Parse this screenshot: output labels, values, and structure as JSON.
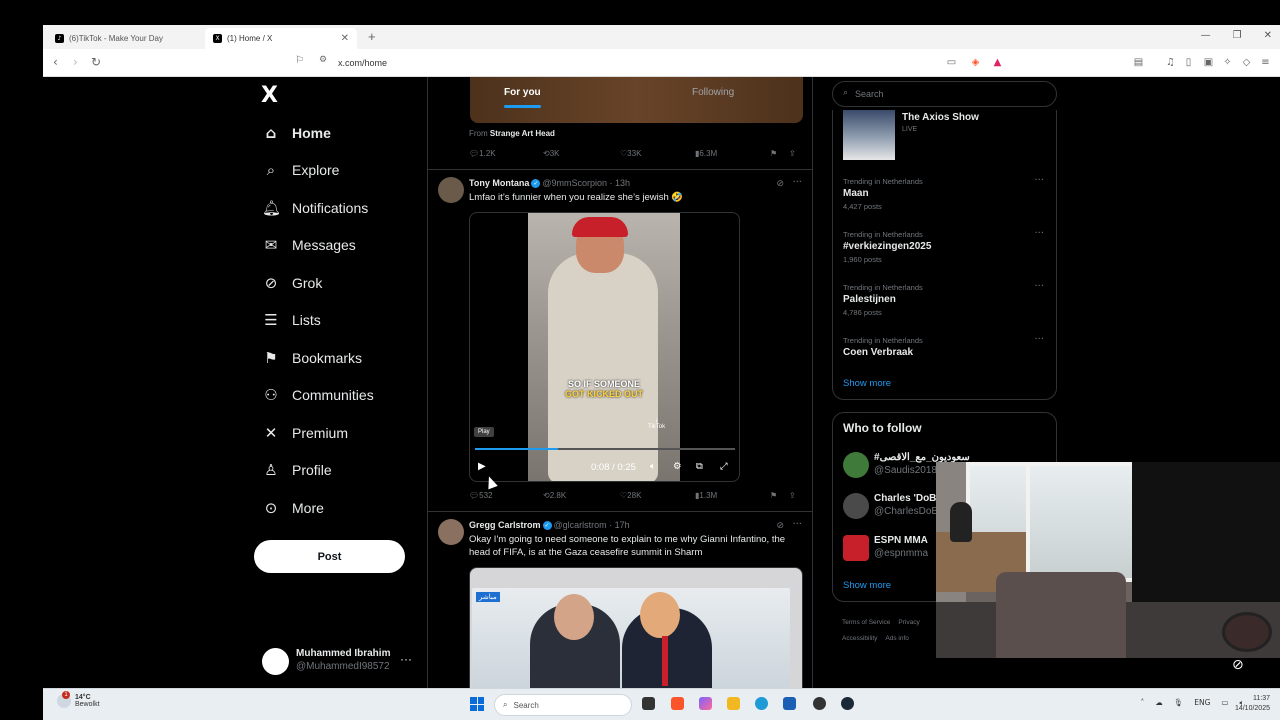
{
  "browser": {
    "tabs": [
      {
        "label": "(6)TikTok - Make Your Day",
        "active": false
      },
      {
        "label": "(1) Home / X",
        "active": true
      }
    ],
    "new_tab": "+",
    "url": "x.com/home"
  },
  "nav": {
    "logo": "X",
    "items": [
      {
        "label": "Home",
        "icon": "home-icon",
        "glyph": "⌂"
      },
      {
        "label": "Explore",
        "icon": "search-icon",
        "glyph": "⌕"
      },
      {
        "label": "Notifications",
        "icon": "bell-icon",
        "glyph": "♫"
      },
      {
        "label": "Messages",
        "icon": "envelope-icon",
        "glyph": "✉"
      },
      {
        "label": "Grok",
        "icon": "grok-icon",
        "glyph": "⊘"
      },
      {
        "label": "Lists",
        "icon": "list-icon",
        "glyph": "☰"
      },
      {
        "label": "Bookmarks",
        "icon": "bookmark-icon",
        "glyph": "⚑"
      },
      {
        "label": "Communities",
        "icon": "people-icon",
        "glyph": "⚇"
      },
      {
        "label": "Premium",
        "icon": "x-premium-icon",
        "glyph": "✕"
      },
      {
        "label": "Profile",
        "icon": "person-icon",
        "glyph": "♙"
      },
      {
        "label": "More",
        "icon": "more-circle-icon",
        "glyph": "⊙"
      }
    ],
    "post_label": "Post",
    "account": {
      "name": "Muhammed Ibrahim",
      "handle": "@MuhammedI98572",
      "more": "···"
    }
  },
  "timeline": {
    "tabs": [
      "For you",
      "Following"
    ],
    "from_prefix": "From ",
    "from_name": "Strange Art Head",
    "first_actions": {
      "replies": "1.2K",
      "reposts": "3K",
      "likes": "33K",
      "views": "6.3M"
    },
    "tweets": [
      {
        "name": "Tony Montana",
        "handle_time": "@9mmScorpion · 13h",
        "text": "Lmfao it’s funnier when you realize she’s jewish 🤣",
        "video": {
          "sub_line1": "SO IF SOMEONE",
          "sub_line2a": "GOT ",
          "sub_line2b": "KICKED",
          "sub_line2c": " OUT",
          "badge": "Play",
          "time": "0:08 / 0:25",
          "progress": 0.32,
          "watermark": "TikTok"
        },
        "actions": {
          "replies": "532",
          "reposts": "2.8K",
          "likes": "28K",
          "views": "1.3M"
        }
      },
      {
        "name": "Gregg Carlstrom",
        "handle_time": "@glcarlstrom · 17h",
        "text": "Okay I'm going to need someone to explain to me why Gianni Infantino, the head of FIFA, is at the Gaza ceasefire summit in Sharm",
        "image_label": "مباشر"
      }
    ]
  },
  "right": {
    "search_placeholder": "Search",
    "live": {
      "title": "The Axios Show",
      "status": "LIVE"
    },
    "trends": [
      {
        "context": "Trending in Netherlands",
        "name": "Maan",
        "count": "4,427 posts"
      },
      {
        "context": "Trending in Netherlands",
        "name": "#verkiezingen2025",
        "count": "1,960 posts"
      },
      {
        "context": "Trending in Netherlands",
        "name": "Palestijnen",
        "count": "4,786 posts"
      },
      {
        "context": "Trending in Netherlands",
        "name": "Coen Verbraak",
        "count": ""
      }
    ],
    "show_more": "Show more",
    "who_to_follow": {
      "title": "Who to follow",
      "accounts": [
        {
          "name": "#سعوديون_مع_الاقصى",
          "handle": "@Saudis2018"
        },
        {
          "name": "Charles 'DoBr",
          "handle": "@CharlesDoBr"
        },
        {
          "name": "ESPN MMA",
          "handle": "@espnmma"
        }
      ],
      "show_more": "Show more"
    },
    "footer": [
      "Terms of Service",
      "Privacy",
      "Accessibility",
      "Ads info"
    ]
  },
  "taskbar": {
    "weather_temp": "14°C",
    "weather_desc": "Bewolkt",
    "search": "Search",
    "lang": "ENG",
    "time": "11:37",
    "date": "14/10/2025"
  },
  "colors": {
    "accent": "#1d9bf0",
    "background": "#000000",
    "border": "#2f3336",
    "muted": "#71767b"
  }
}
